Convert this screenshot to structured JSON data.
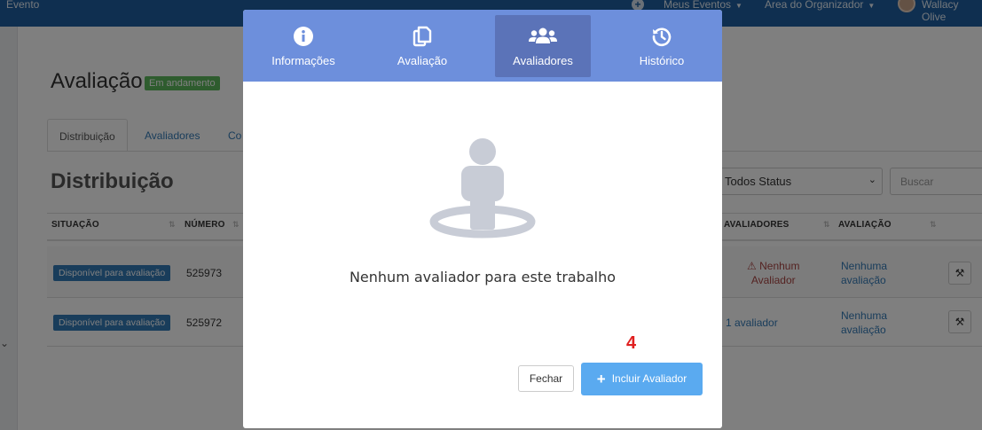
{
  "topbar": {
    "brand": "Evento",
    "items": [
      {
        "label": "Meus Eventos"
      },
      {
        "label": "Área do Organizador"
      },
      {
        "label": "Wallacy Olive"
      }
    ]
  },
  "page": {
    "title": "Avaliação",
    "badge": "Em andamento",
    "tabs": [
      "Distribuição",
      "Avaliadores",
      "Co"
    ],
    "section_title": "Distribuição",
    "filters": {
      "status_selected": "Todos Status",
      "search_placeholder": "Buscar"
    },
    "table": {
      "headers": [
        "SITUAÇÃO",
        "NÚMERO",
        "AVALIADORES",
        "AVALIAÇÃO"
      ],
      "rows": [
        {
          "situacao": "Disponível para avaliação",
          "numero": "525973",
          "avaliadores_1": "Nenhum",
          "avaliadores_2": "Avaliador",
          "avaliacao_1": "Nenhuma",
          "avaliacao_2": "avaliação"
        },
        {
          "situacao": "Disponível para avaliação",
          "numero": "525972",
          "avaliadores": "1 avaliador",
          "avaliacao_1": "Nenhuma",
          "avaliacao_2": "avaliação"
        }
      ]
    }
  },
  "modal": {
    "tabs": [
      {
        "label": "Informações",
        "icon": "info-circle-icon"
      },
      {
        "label": "Avaliação",
        "icon": "copy-document-icon"
      },
      {
        "label": "Avaliadores",
        "icon": "users-icon",
        "active": true
      },
      {
        "label": "Histórico",
        "icon": "history-icon"
      }
    ],
    "empty_message": "Nenhum avaliador para este trabalho",
    "step_marker": "4",
    "close_label": "Fechar",
    "add_label": "Incluir Avaliador"
  },
  "colors": {
    "navbar": "#1e5fa0",
    "modal_header": "#6d8fdc",
    "modal_tab_active": "#5b73b8",
    "primary_button": "#5aaaf0",
    "badge_success": "#5cb85c",
    "status_pill": "#337ab7",
    "step_marker": "#e02020"
  }
}
